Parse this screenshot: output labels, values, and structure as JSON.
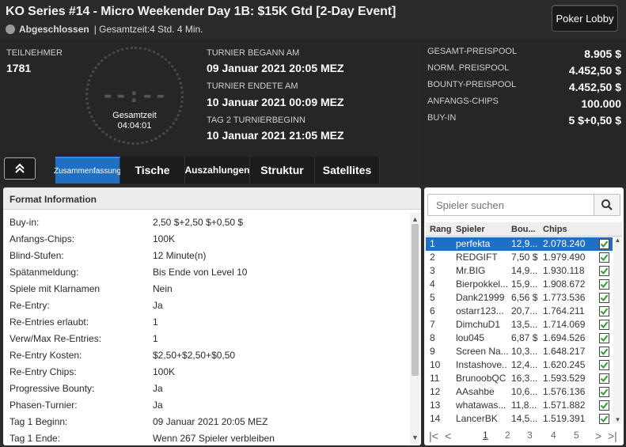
{
  "header": {
    "title": "KO Series #14 - Micro Weekender Day 1B: $15K Gtd [2-Day Event]",
    "status": "Abgeschlossen",
    "total_time": "| Gesamtzeit:4 Std.  4 Min.",
    "lobby_button": "Poker Lobby"
  },
  "participants": {
    "label": "TEILNEHMER",
    "value": "1781"
  },
  "clock": {
    "digits": "--:--",
    "label": "Gesamtzeit",
    "time": "04:04:01"
  },
  "times": [
    {
      "label": "TURNIER BEGANN AM",
      "value": "09 Januar 2021  20:05 MEZ"
    },
    {
      "label": "TURNIER ENDETE AM",
      "value": "10 Januar 2021  00:09 MEZ"
    },
    {
      "label": "TAG 2 TURNIERBEGINN",
      "value": "10 Januar 2021  21:05 MEZ"
    }
  ],
  "prizes": [
    {
      "label": "GESAMT-PREISPOOL",
      "value": "8.905 $"
    },
    {
      "label": "NORM. PREISPOOL",
      "value": "4.452,50 $"
    },
    {
      "label": "BOUNTY-PREISPOOL",
      "value": "4.452,50 $"
    },
    {
      "label": "ANFANGS-CHIPS",
      "value": "100.000"
    },
    {
      "label": "BUY-IN",
      "value": "5 $+0,50 $"
    }
  ],
  "tabs": [
    "Zusammenfassung",
    "Tische",
    "Auszahlungen",
    "Struktur",
    "Satellites"
  ],
  "format": {
    "title": "Format Information",
    "rows": [
      {
        "k": "Buy-in:",
        "v": "2,50 $+2,50 $+0,50 $"
      },
      {
        "k": "Anfangs-Chips:",
        "v": "100K"
      },
      {
        "k": "Blind-Stufen:",
        "v": "12 Minute(n)"
      },
      {
        "k": "Spätanmeldung:",
        "v": "Bis Ende von Level 10"
      },
      {
        "k": "Spiele mit Klarnamen",
        "v": "Nein"
      },
      {
        "k": "Re-Entry:",
        "v": "Ja"
      },
      {
        "k": "Re-Entries erlaubt:",
        "v": "1"
      },
      {
        "k": "Verw/Max Re-Entries:",
        "v": "1"
      },
      {
        "k": "Re-Entry Kosten:",
        "v": "$2,50+$2,50+$0,50"
      },
      {
        "k": "Re-Entry Chips:",
        "v": "100K"
      },
      {
        "k": "Progressive Bounty:",
        "v": "Ja"
      },
      {
        "k": "Phasen-Turnier:",
        "v": "Ja"
      },
      {
        "k": "Tag 1 Beginn:",
        "v": "09 Januar 2021  20:05 MEZ"
      },
      {
        "k": "Tag 1 Ende:",
        "v": "Wenn 267 Spieler verbleiben"
      }
    ]
  },
  "players": {
    "search_placeholder": "Spieler suchen",
    "headers": [
      "Rang",
      "Spieler",
      "Bou...",
      "Chips"
    ],
    "rows": [
      {
        "rank": "1",
        "name": "perfekta",
        "bounty": "12,9...",
        "chips": "2.078.240"
      },
      {
        "rank": "2",
        "name": "REDGIFT",
        "bounty": "7,50 $",
        "chips": "1.979.490"
      },
      {
        "rank": "3",
        "name": "Mr.BIG",
        "bounty": "14,9...",
        "chips": "1.930.118"
      },
      {
        "rank": "4",
        "name": "Bierpokkel...",
        "bounty": "15,9...",
        "chips": "1.908.672"
      },
      {
        "rank": "5",
        "name": "Dank21999",
        "bounty": "6,56 $",
        "chips": "1.773.536"
      },
      {
        "rank": "6",
        "name": "ostarr123...",
        "bounty": "20,7...",
        "chips": "1.764.211"
      },
      {
        "rank": "7",
        "name": "DimchuD1",
        "bounty": "13,5...",
        "chips": "1.714.069"
      },
      {
        "rank": "8",
        "name": "lou045",
        "bounty": "6,87 $",
        "chips": "1.694.526"
      },
      {
        "rank": "9",
        "name": "Screen Na...",
        "bounty": "10,3...",
        "chips": "1.648.217"
      },
      {
        "rank": "10",
        "name": "Instashove...",
        "bounty": "12,4...",
        "chips": "1.620.245"
      },
      {
        "rank": "11",
        "name": "BrunoobQC",
        "bounty": "16,3...",
        "chips": "1.593.529"
      },
      {
        "rank": "12",
        "name": "AAsahbe",
        "bounty": "10,6...",
        "chips": "1.576.136"
      },
      {
        "rank": "13",
        "name": "whatawas...",
        "bounty": "11,8...",
        "chips": "1.571.882"
      },
      {
        "rank": "14",
        "name": "LancerBK",
        "bounty": "14,5...",
        "chips": "1.519.391"
      }
    ],
    "pages": [
      "1",
      "2",
      "3",
      "4",
      "5"
    ]
  },
  "colors": {
    "accent": "#1f6fc5",
    "check": "#2e9e2e"
  }
}
